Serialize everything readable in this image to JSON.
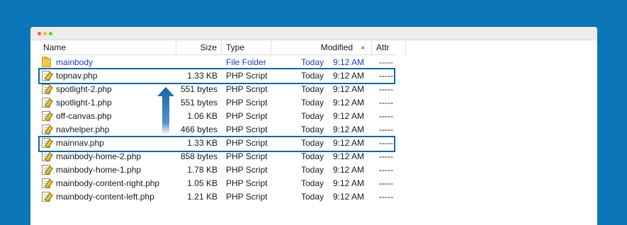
{
  "window": {
    "controls": [
      "close",
      "minimize",
      "maximize"
    ],
    "colors": {
      "background": "#0a76b8",
      "highlight": "#1466a4",
      "folder_text": "#1f3ec7"
    }
  },
  "columns": {
    "name": "Name",
    "size": "Size",
    "type": "Type",
    "modified": "Modified",
    "sort_icon": "▲",
    "attr": "Attr"
  },
  "files": [
    {
      "icon": "folder-icon",
      "name": "mainbody",
      "size": "",
      "type": "File Folder",
      "day": "Today",
      "time": "9:12 AM",
      "attr": "-----"
    },
    {
      "icon": "php-file-icon",
      "name": "topnav.php",
      "size": "1.33 KB",
      "type": "PHP Script",
      "day": "Today",
      "time": "9:12 AM",
      "attr": "-----"
    },
    {
      "icon": "php-file-icon",
      "name": "spotlight-2.php",
      "size": "551 bytes",
      "type": "PHP Script",
      "day": "Today",
      "time": "9:12 AM",
      "attr": "-----"
    },
    {
      "icon": "php-file-icon",
      "name": "spotlight-1.php",
      "size": "551 bytes",
      "type": "PHP Script",
      "day": "Today",
      "time": "9:12 AM",
      "attr": "-----"
    },
    {
      "icon": "php-file-icon",
      "name": "off-canvas.php",
      "size": "1.06 KB",
      "type": "PHP Script",
      "day": "Today",
      "time": "9:12 AM",
      "attr": "-----"
    },
    {
      "icon": "php-file-icon",
      "name": "navhelper.php",
      "size": "466 bytes",
      "type": "PHP Script",
      "day": "Today",
      "time": "9:12 AM",
      "attr": "-----"
    },
    {
      "icon": "php-file-icon",
      "name": "mainnav.php",
      "size": "1.33 KB",
      "type": "PHP Script",
      "day": "Today",
      "time": "9:12 AM",
      "attr": "-----"
    },
    {
      "icon": "php-file-icon",
      "name": "mainbody-home-2.php",
      "size": "858 bytes",
      "type": "PHP Script",
      "day": "Today",
      "time": "9:12 AM",
      "attr": "-----"
    },
    {
      "icon": "php-file-icon",
      "name": "mainbody-home-1.php",
      "size": "1.78 KB",
      "type": "PHP Script",
      "day": "Today",
      "time": "9:12 AM",
      "attr": "-----"
    },
    {
      "icon": "php-file-icon",
      "name": "mainbody-content-right.php",
      "size": "1.05 KB",
      "type": "PHP Script",
      "day": "Today",
      "time": "9:12 AM",
      "attr": "-----"
    },
    {
      "icon": "php-file-icon",
      "name": "mainbody-content-left.php",
      "size": "1.21 KB",
      "type": "PHP Script",
      "day": "Today",
      "time": "9:12 AM",
      "attr": "-----"
    }
  ],
  "annotation": {
    "arrow_icon": "up-arrow-icon",
    "from_file": "mainnav.php",
    "to_file": "topnav.php"
  }
}
